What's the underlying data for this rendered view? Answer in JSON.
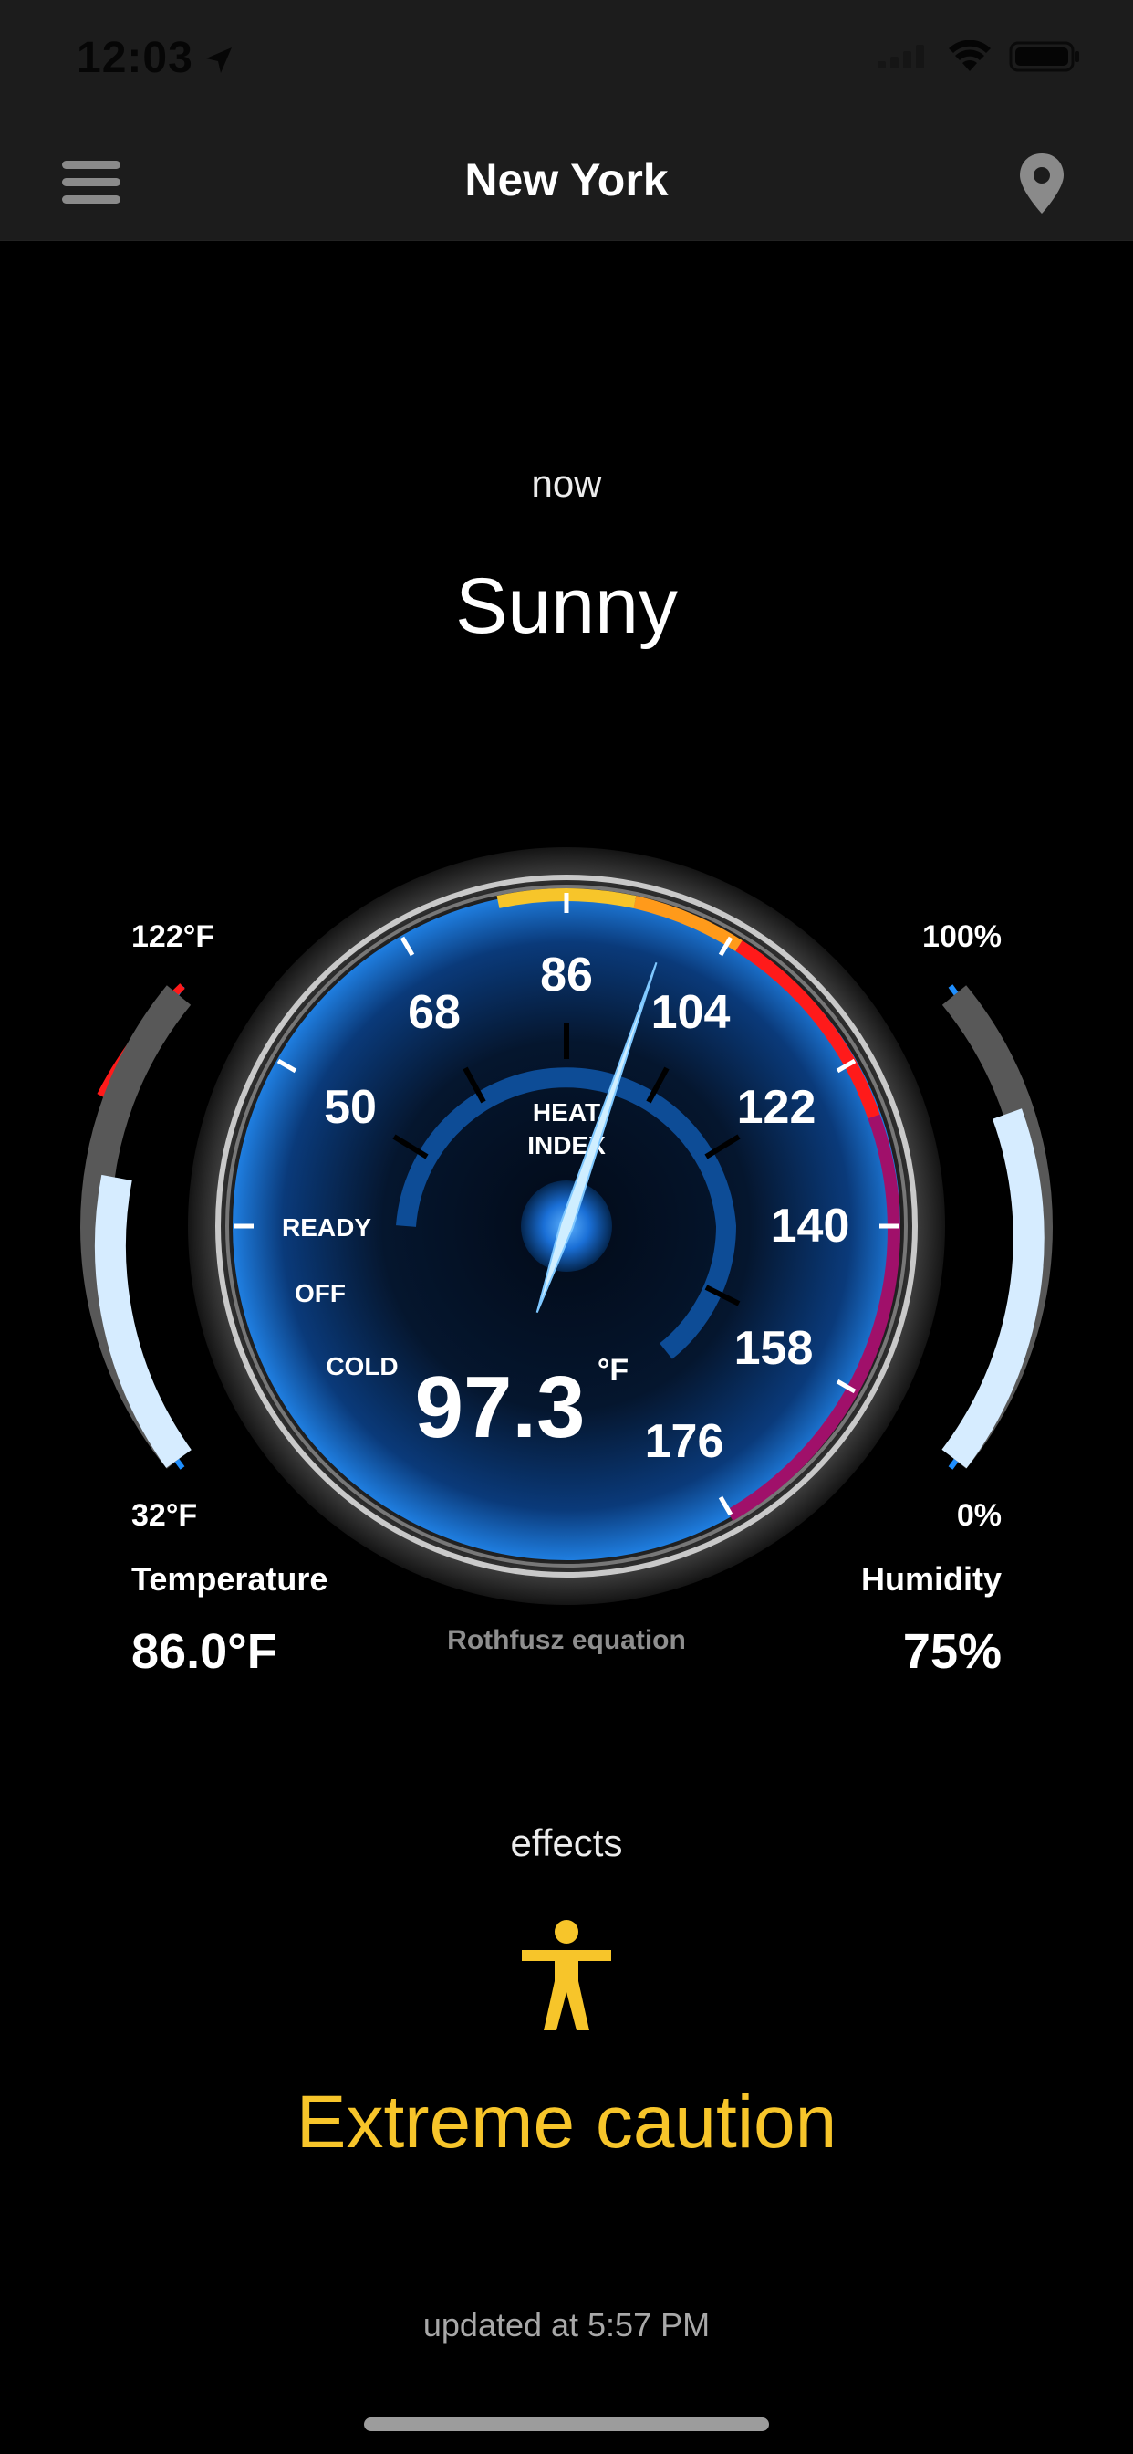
{
  "status_bar": {
    "time": "12:03"
  },
  "nav": {
    "title": "New York",
    "menu_icon": "hamburger-icon",
    "location_icon": "map-pin-icon"
  },
  "current": {
    "time_label": "now",
    "condition": "Sunny"
  },
  "gauge": {
    "heat_index_label_line1": "HEAT",
    "heat_index_label_line2": "INDEX",
    "value": "97.3",
    "unit": "°F",
    "scale": [
      "50",
      "68",
      "86",
      "104",
      "122",
      "140",
      "158",
      "176"
    ],
    "status_labels": [
      "READY",
      "OFF",
      "COLD"
    ],
    "needle_value": 97.3,
    "equation": "Rothfusz equation",
    "colors": {
      "blue": "#1f8fff",
      "yellow": "#f7c52a",
      "orange": "#ff9a1a",
      "red": "#ff1a1a",
      "purple": "#a0106a"
    }
  },
  "temperature": {
    "max_label": "122°F",
    "min_label": "32°F",
    "title": "Temperature",
    "value": "86.0°F",
    "level": 0.6
  },
  "humidity": {
    "max_label": "100%",
    "min_label": "0%",
    "title": "Humidity",
    "value": "75%",
    "level": 0.75
  },
  "effects": {
    "label": "effects",
    "icon": "person-icon",
    "text": "Extreme caution",
    "color": "#f7c52a"
  },
  "footer": {
    "updated": "updated at 5:57 PM"
  }
}
